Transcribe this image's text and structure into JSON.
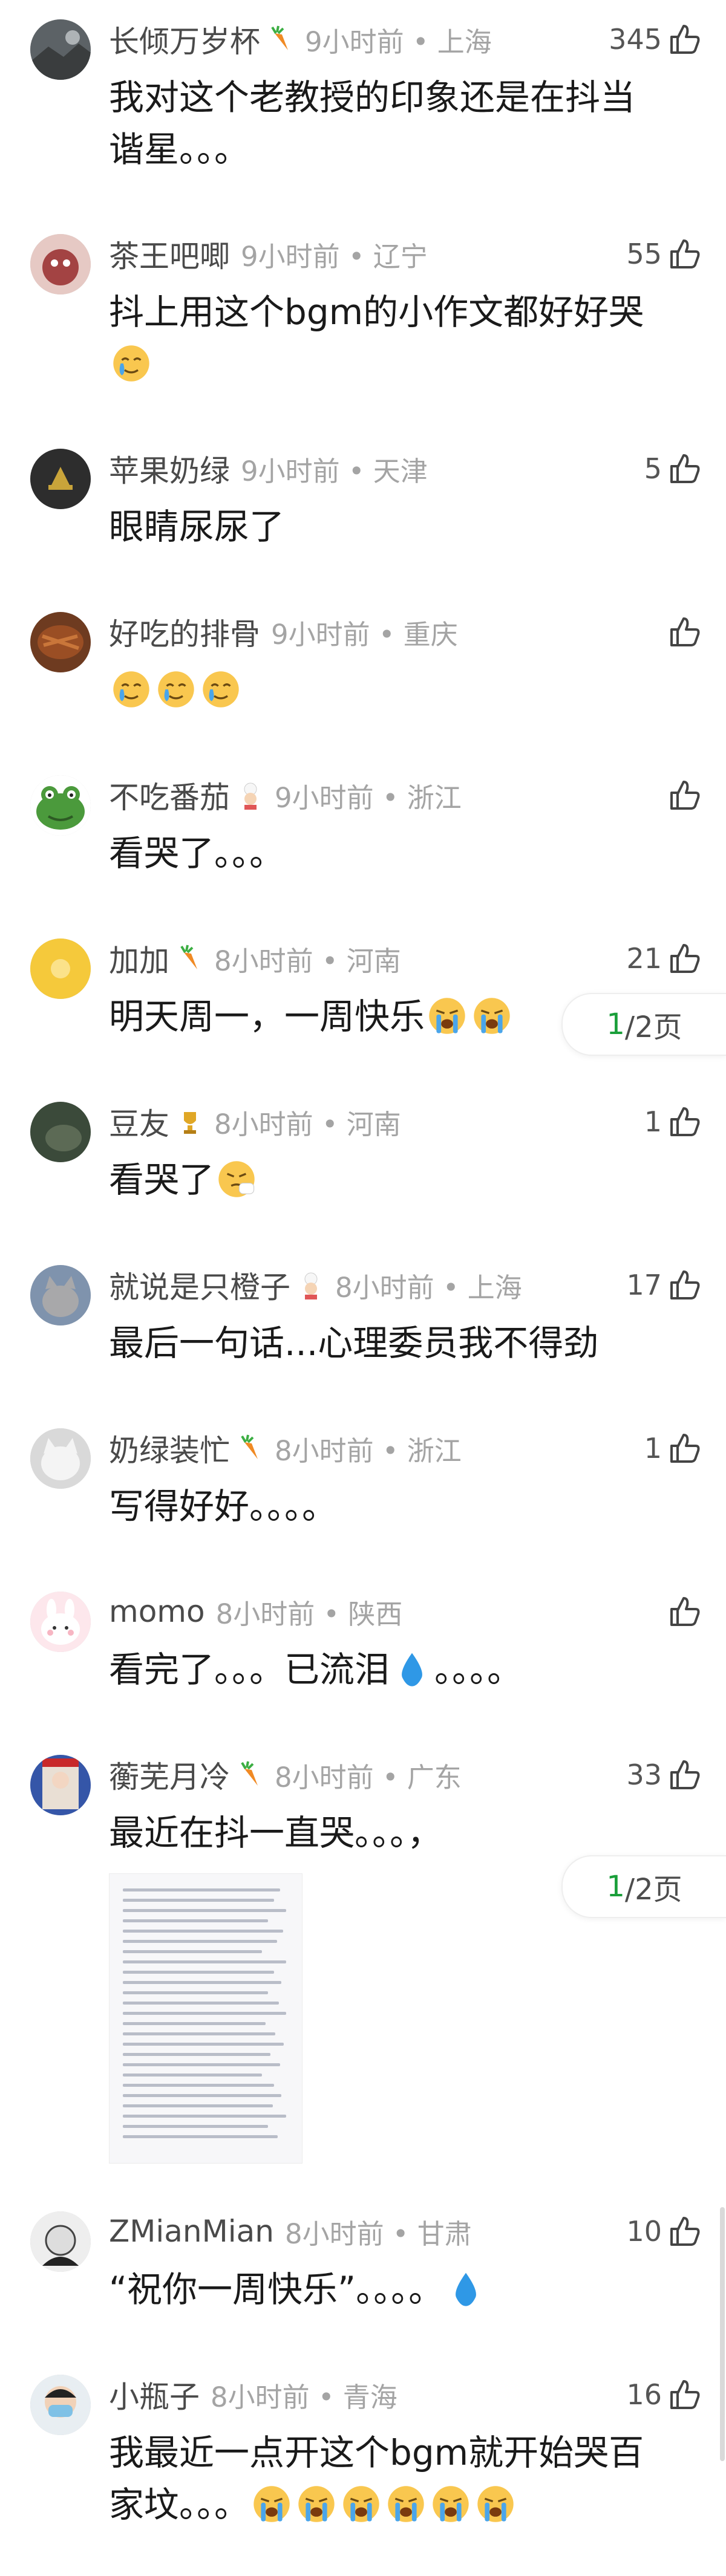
{
  "comments": [
    {
      "name": "长倾万岁杯",
      "badge": "carrot",
      "time": "9小时前",
      "location": "上海",
      "likes": "345",
      "text": "我对这个老教授的印象还是在抖当谐星。。。",
      "avatar": "dark-landscape"
    },
    {
      "name": "茶王吧唧",
      "badge": "",
      "time": "9小时前",
      "location": "辽宁",
      "likes": "55",
      "text": "抖上用这个bgm的小作文都好好哭",
      "emojis": [
        "cry-smile"
      ],
      "avatar": "reddish-dragon"
    },
    {
      "name": "苹果奶绿",
      "badge": "",
      "time": "9小时前",
      "location": "天津",
      "likes": "5",
      "text": "眼睛尿尿了",
      "avatar": "dark-golden"
    },
    {
      "name": "好吃的排骨",
      "badge": "",
      "time": "9小时前",
      "location": "重庆",
      "likes": "",
      "text": "",
      "emojis": [
        "cry-smile",
        "cry-smile",
        "cry-smile"
      ],
      "avatar": "ribs"
    },
    {
      "name": "不吃番茄",
      "badge": "chef",
      "time": "9小时前",
      "location": "浙江",
      "likes": "",
      "text": "看哭了。。。",
      "avatar": "frog"
    },
    {
      "name": "加加",
      "badge": "carrot",
      "time": "8小时前",
      "location": "河南",
      "likes": "21",
      "text": "明天周一，一周快乐",
      "emojis": [
        "loud-cry",
        "loud-cry"
      ],
      "avatar": "yellow-circle",
      "pager": {
        "current": "1",
        "total": "/2页"
      }
    },
    {
      "name": "豆友",
      "badge": "trophy",
      "time": "8小时前",
      "location": "河南",
      "likes": "1",
      "text": "看哭了",
      "emojis": [
        "sneeze"
      ],
      "avatar": "dark-green"
    },
    {
      "name": "就说是只橙子",
      "badge": "chef",
      "time": "8小时前",
      "location": "上海",
      "likes": "17",
      "text": "最后一句话...心理委员我不得劲",
      "avatar": "cat-grey"
    },
    {
      "name": "奶绿装忙",
      "badge": "carrot",
      "time": "8小时前",
      "location": "浙江",
      "likes": "1",
      "text": "写得好好。。。。",
      "avatar": "white-cat"
    },
    {
      "name": "momo",
      "badge": "",
      "time": "8小时前",
      "location": "陕西",
      "likes": "",
      "text": "看完了。。。已流泪",
      "text_after": "。。。。",
      "emojis": [
        "droplet"
      ],
      "avatar": "pink-bunny"
    },
    {
      "name": "蘅芜月冷",
      "badge": "carrot",
      "time": "8小时前",
      "location": "广东",
      "likes": "33",
      "text": "最近在抖一直哭。。。，",
      "avatar": "anime",
      "pager": {
        "current": "1",
        "total": "/2页"
      },
      "has_image": true
    },
    {
      "name": "ZMianMian",
      "badge": "",
      "time": "8小时前",
      "location": "甘肃",
      "likes": "10",
      "text": "“祝你一周快乐”。。。。",
      "emojis": [
        "droplet"
      ],
      "avatar": "sketch-face"
    },
    {
      "name": "小瓶子",
      "badge": "",
      "time": "8小时前",
      "location": "青海",
      "likes": "16",
      "text": "我最近一点开这个bgm就开始哭百家坟。。。",
      "emojis": [
        "loud-cry",
        "loud-cry",
        "loud-cry",
        "loud-cry",
        "loud-cry",
        "loud-cry"
      ],
      "avatar": "masked-boy"
    }
  ],
  "colors": {
    "name": "#4a4a4a",
    "meta": "#a4a4a4",
    "text": "#1a1a1a",
    "pager_current": "#1a9f3a"
  }
}
